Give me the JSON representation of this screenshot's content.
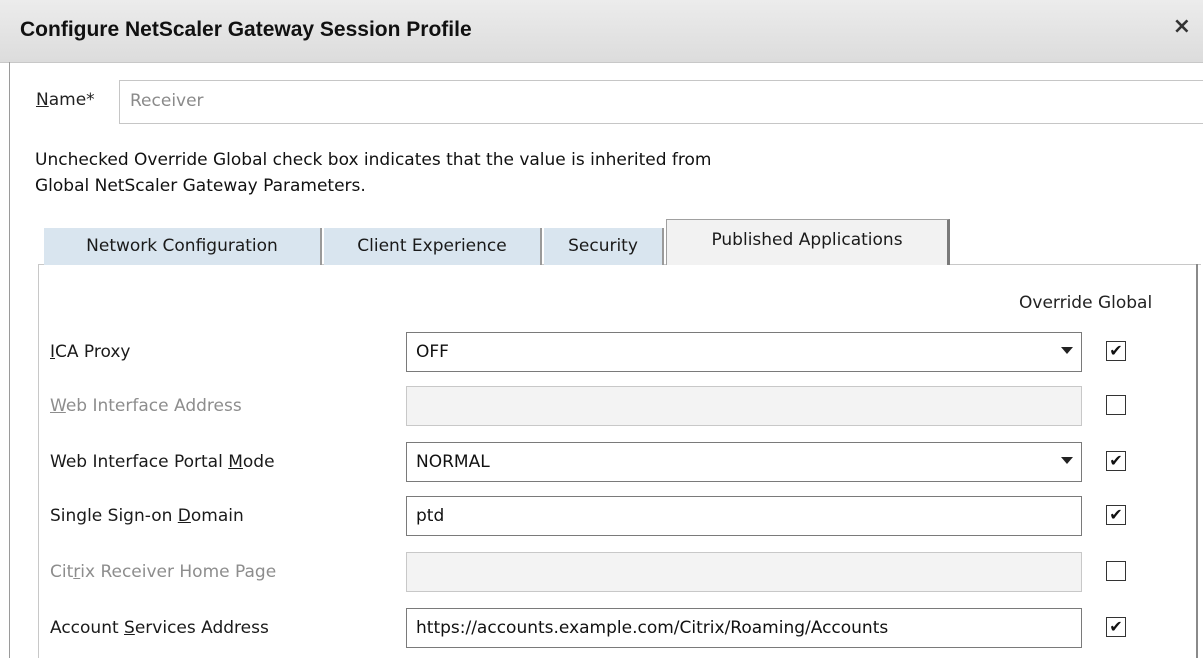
{
  "dialog": {
    "title": "Configure NetScaler Gateway Session Profile",
    "close_glyph": "×"
  },
  "name_field": {
    "label_underlined": "N",
    "label_rest": "ame*",
    "value": "Receiver"
  },
  "note": {
    "line1": "Unchecked Override Global check box indicates that the value is inherited from",
    "line2": "Global NetScaler Gateway Parameters."
  },
  "tabs": [
    {
      "label": "Network Configuration",
      "active": false
    },
    {
      "label": "Client Experience",
      "active": false
    },
    {
      "label": "Security",
      "active": false
    },
    {
      "label": "Published Applications",
      "active": true
    }
  ],
  "override_header": "Override Global",
  "check_glyph": "✔",
  "rows": [
    {
      "label_pre": "",
      "label_u": "I",
      "label_post": "CA Proxy",
      "value": "OFF",
      "type": "select",
      "enabled": true,
      "override": true
    },
    {
      "label_pre": "",
      "label_u": "W",
      "label_post": "eb Interface Address",
      "value": "",
      "type": "text",
      "enabled": false,
      "override": false
    },
    {
      "label_pre": "Web Interface Portal ",
      "label_u": "M",
      "label_post": "ode",
      "value": "NORMAL",
      "type": "select",
      "enabled": true,
      "override": true
    },
    {
      "label_pre": "Single Sign-on ",
      "label_u": "D",
      "label_post": "omain",
      "value": "ptd",
      "type": "text",
      "enabled": true,
      "override": true
    },
    {
      "label_pre": "Cit",
      "label_u": "r",
      "label_post": "ix Receiver Home Page",
      "value": "",
      "type": "text",
      "enabled": false,
      "override": false
    },
    {
      "label_pre": "Account ",
      "label_u": "S",
      "label_post": "ervices Address",
      "value": "https://accounts.example.com/Citrix/Roaming/Accounts",
      "type": "text",
      "enabled": true,
      "override": true
    }
  ]
}
